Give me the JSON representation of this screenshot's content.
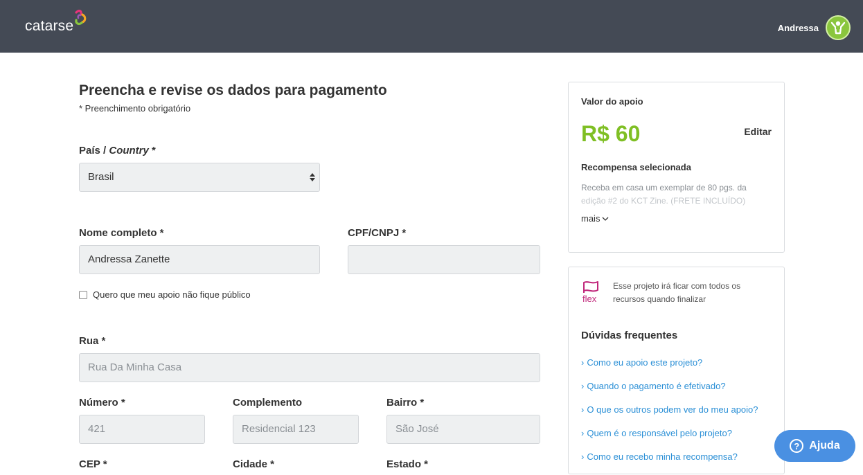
{
  "header": {
    "logo_text": "catarse",
    "user_name": "Andressa",
    "accent": "#444a55"
  },
  "form": {
    "title": "Preencha e revise os dados para pagamento",
    "required_note": "* Preenchimento obrigatório",
    "country": {
      "label_main": "País / ",
      "label_italic": "Country",
      "label_star": " *",
      "value": "Brasil"
    },
    "full_name": {
      "label": "Nome completo *",
      "value": "Andressa Zanette"
    },
    "cpf": {
      "label": "CPF/CNPJ *",
      "value": ""
    },
    "anonymous": {
      "label": "Quero que meu apoio não fique público",
      "checked": false
    },
    "street": {
      "label": "Rua *",
      "placeholder": "Rua Da Minha Casa"
    },
    "number": {
      "label": "Número *",
      "placeholder": "421"
    },
    "complement": {
      "label": "Complemento",
      "placeholder": "Residencial 123"
    },
    "neighborhood": {
      "label": "Bairro *",
      "placeholder": "São José"
    },
    "cep": {
      "label": "CEP *"
    },
    "city": {
      "label": "Cidade *"
    },
    "state": {
      "label": "Estado *"
    }
  },
  "summary": {
    "value_label": "Valor do apoio",
    "amount": "R$ 60",
    "edit_label": "Editar",
    "reward_label": "Recompensa selecionada",
    "reward_line1": "Receba em casa um exemplar de 80 pgs. da",
    "reward_line2": "edição #2 do KCT Zine.  (FRETE INCLUÍDO)",
    "more_label": "mais",
    "amount_color": "#7fbf24"
  },
  "info": {
    "flex_label": "flex",
    "flex_text": "Esse projeto irá ficar com todos os recursos quando finalizar",
    "faq_title": "Dúvidas frequentes",
    "faq": [
      "Como eu apoio este projeto?",
      "Quando o pagamento é efetivado?",
      "O que os outros podem ver do meu apoio?",
      "Quem é o responsável pelo projeto?",
      "Como eu recebo minha recompensa?"
    ],
    "link_color": "#2a8fd6"
  },
  "help": {
    "label": "Ajuda",
    "color": "#4a90e2"
  }
}
